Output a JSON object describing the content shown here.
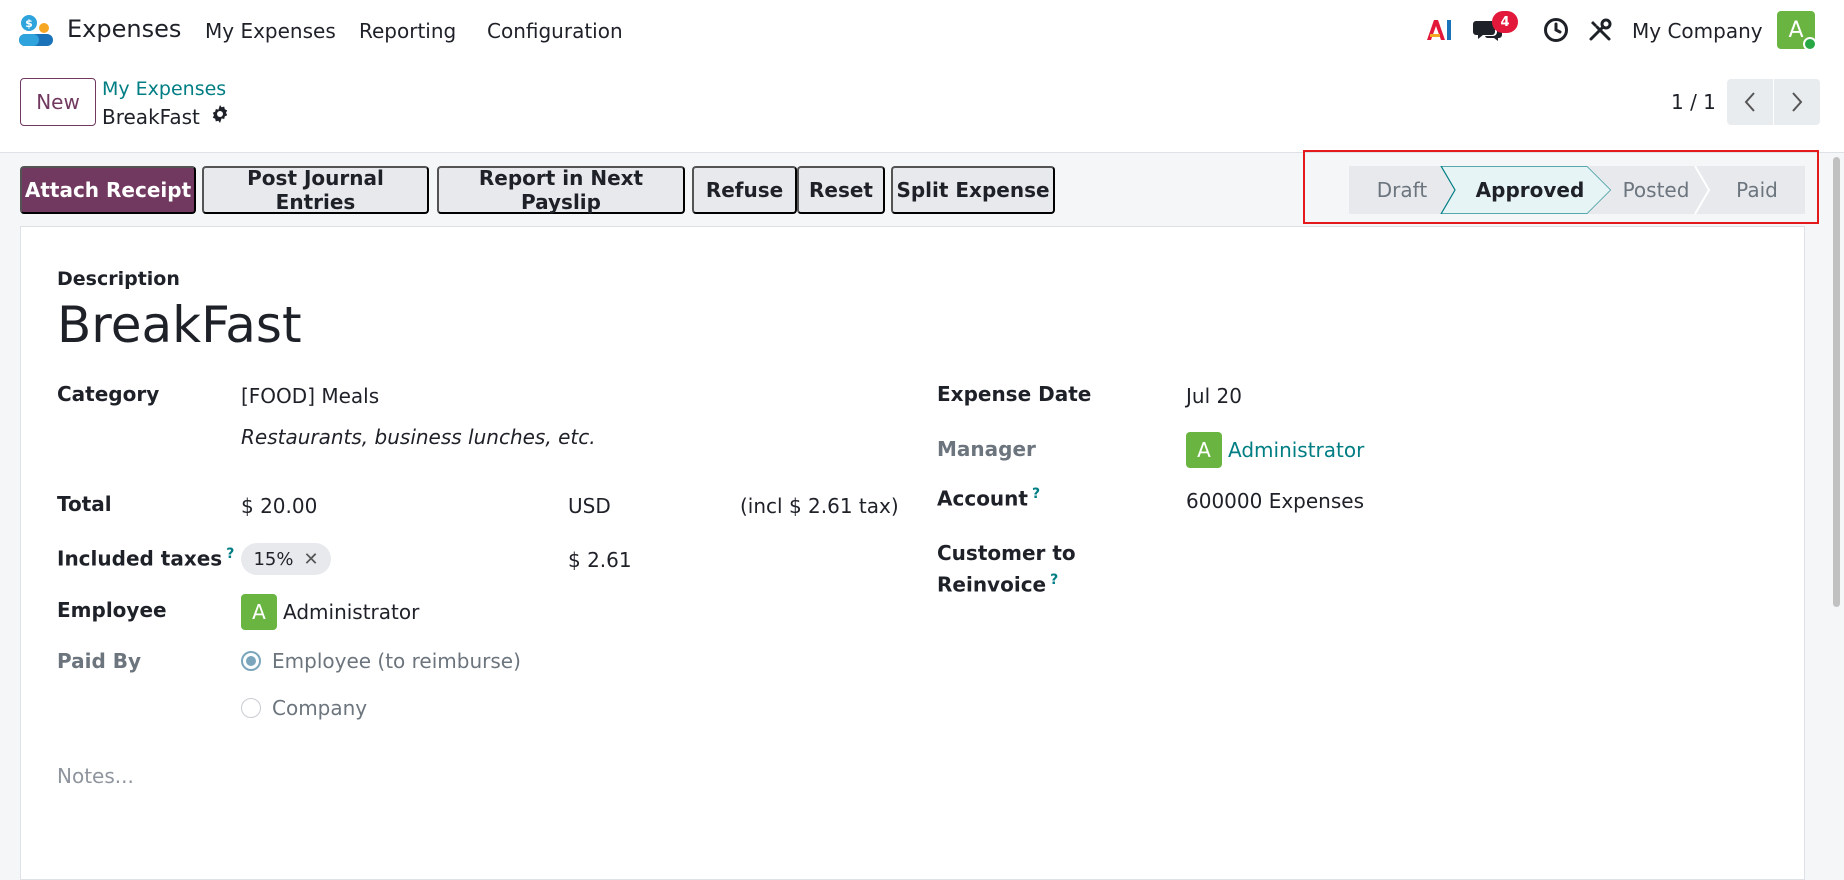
{
  "navbar": {
    "app_name": "Expenses",
    "menu": [
      "My Expenses",
      "Reporting",
      "Configuration"
    ],
    "messages_badge": "4",
    "company": "My Company",
    "user_initial": "A"
  },
  "control_panel": {
    "new_label": "New",
    "breadcrumb_parent": "My Expenses",
    "breadcrumb_current": "BreakFast",
    "pager": "1 / 1"
  },
  "actions": {
    "attach_receipt": "Attach Receipt",
    "post_journal": "Post Journal Entries",
    "report_payslip": "Report in Next Payslip",
    "refuse": "Refuse",
    "reset": "Reset",
    "split_expense": "Split Expense"
  },
  "status": {
    "stages": [
      "Draft",
      "Approved",
      "Posted",
      "Paid"
    ],
    "current": "Approved"
  },
  "form": {
    "description_label": "Description",
    "title": "BreakFast",
    "category_label": "Category",
    "category_value": "[FOOD] Meals",
    "category_note": "Restaurants, business lunches, etc.",
    "total_label": "Total",
    "total_value": "$ 20.00",
    "currency": "USD",
    "tax_note": "(incl $ 2.61 tax)",
    "included_taxes_label": "Included taxes",
    "tax_tag": "15%",
    "tax_amount": "$ 2.61",
    "employee_label": "Employee",
    "employee_initial": "A",
    "employee_name": "Administrator",
    "paid_by_label": "Paid By",
    "paid_by_options": [
      "Employee (to reimburse)",
      "Company"
    ],
    "expense_date_label": "Expense Date",
    "expense_date_value": "Jul 20",
    "manager_label": "Manager",
    "manager_initial": "A",
    "manager_name": "Administrator",
    "account_label": "Account",
    "account_value": "600000 Expenses",
    "customer_label_1": "Customer to",
    "customer_label_2": "Reinvoice",
    "help_mark": "?",
    "notes_placeholder": "Notes..."
  },
  "colors": {
    "primary": "#71395f",
    "link": "#017e84",
    "badge": "#e3193b",
    "avatar": "#6ab541",
    "highlight": "#e3191b"
  }
}
